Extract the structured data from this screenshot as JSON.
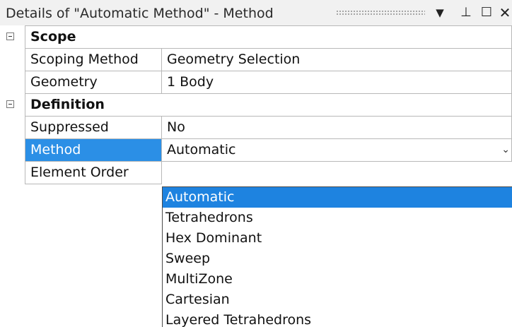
{
  "panel": {
    "title": "Details of \"Automatic Method\" - Method",
    "icons": [
      "dropdown-icon",
      "pin-icon",
      "maximize-icon",
      "close-icon"
    ],
    "title_icons": {
      "dropdown": "▼",
      "pin": "⊥",
      "maximize": "☐",
      "close": "✕"
    }
  },
  "scope": {
    "label": "Scope",
    "scoping_method": {
      "name": "Scoping Method",
      "value": "Geometry Selection"
    },
    "geometry": {
      "name": "Geometry",
      "value": "1 Body"
    }
  },
  "definition": {
    "label": "Definition",
    "suppressed": {
      "name": "Suppressed",
      "value": "No"
    },
    "method": {
      "name": "Method",
      "value": "Automatic"
    },
    "element_order": {
      "name": "Element Order"
    }
  },
  "method_dropdown": {
    "arrow": "⌄",
    "options": [
      "Automatic",
      "Tetrahedrons",
      "Hex Dominant",
      "Sweep",
      "MultiZone",
      "Cartesian",
      "Layered Tetrahedrons"
    ],
    "highlighted": "Automatic"
  },
  "colors": {
    "selection": "#2b8fe6",
    "list_highlight": "#1e83e0",
    "grid_line": "#b8b8b8",
    "title_bar": "#f1f1f1"
  }
}
